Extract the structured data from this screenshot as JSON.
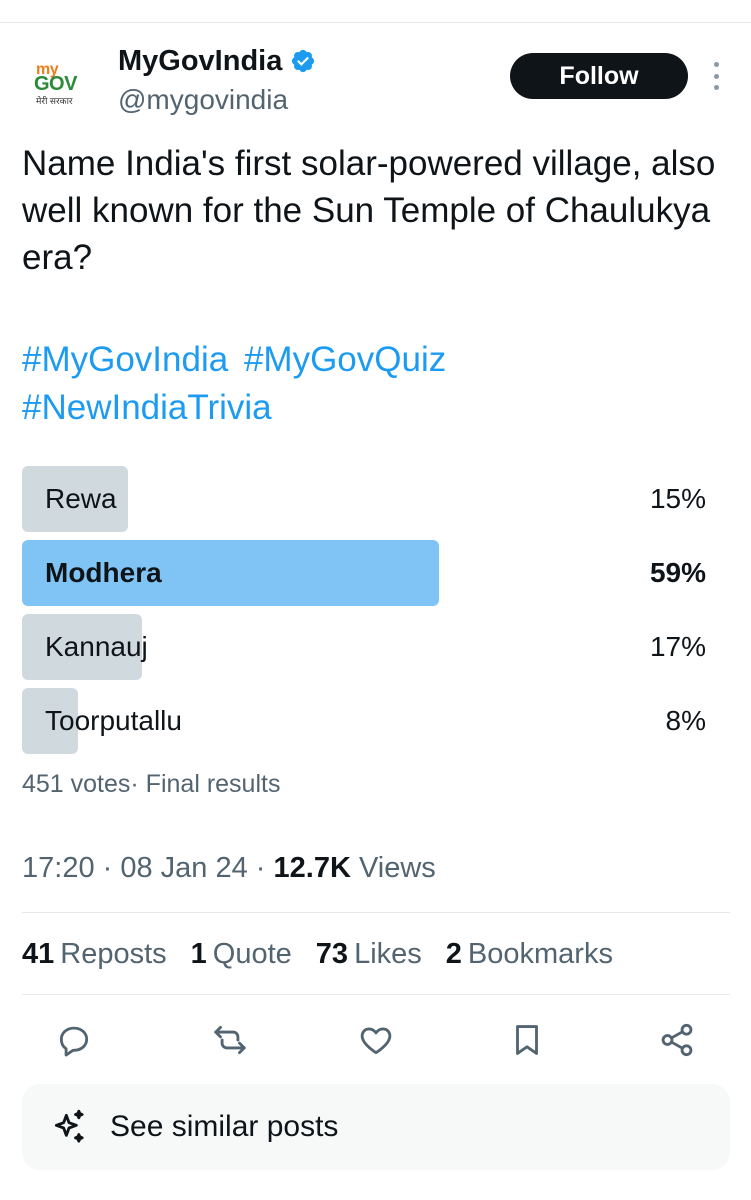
{
  "author": {
    "display_name": "MyGovIndia",
    "handle": "@mygovindia",
    "verified": true,
    "avatar_logo": {
      "my": "my",
      "gov": "GOV",
      "tagline": "मेरी सरकार"
    }
  },
  "header": {
    "follow_label": "Follow"
  },
  "tweet": {
    "text": "Name India's first solar-powered village, also well known for the Sun Temple of Chaulukya era?",
    "hashtags": [
      "#MyGovIndia",
      "#MyGovQuiz",
      "#NewIndiaTrivia"
    ]
  },
  "poll": {
    "options": [
      {
        "label": "Rewa",
        "percent_label": "15%",
        "percent": 15,
        "winner": false
      },
      {
        "label": "Modhera",
        "percent_label": "59%",
        "percent": 59,
        "winner": true
      },
      {
        "label": "Kannauj",
        "percent_label": "17%",
        "percent": 17,
        "winner": false
      },
      {
        "label": "Toorputallu",
        "percent_label": "8%",
        "percent": 8,
        "winner": false
      }
    ],
    "votes_text": "451 votes· Final results"
  },
  "meta": {
    "time": "17:20 · 08 Jan 24 · ",
    "views_count": "12.7K",
    "views_label": " Views"
  },
  "stats": {
    "reposts_count": "41",
    "reposts_label": "Reposts",
    "quotes_count": "1",
    "quotes_label": "Quote",
    "likes_count": "73",
    "likes_label": "Likes",
    "bookmarks_count": "2",
    "bookmarks_label": "Bookmarks"
  },
  "similar": {
    "label": "See similar posts"
  },
  "colors": {
    "accent": "#1d9bf0",
    "poll_winner": "#7fc4f5",
    "poll_other": "#cfd9de",
    "muted_text": "#536471"
  }
}
